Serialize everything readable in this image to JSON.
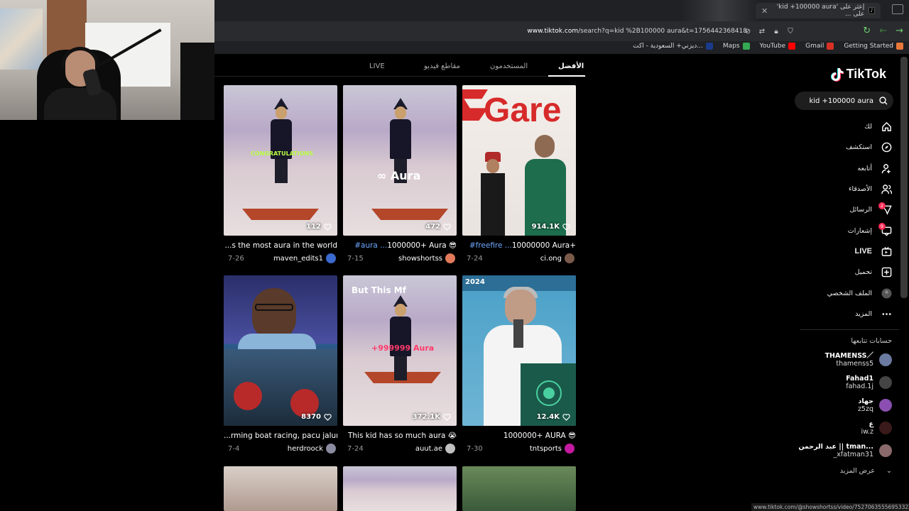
{
  "browser": {
    "tab_title": "إعثر على 'kid +100000 aura' على ...",
    "url_host": "www.tiktok.com",
    "url_path": "/search?q=kid %2B100000 aura&t=1756442368418",
    "bookmarks": [
      {
        "label": "Getting Started",
        "color": "#e8773a"
      },
      {
        "label": "Gmail",
        "color": "#d93025"
      },
      {
        "label": "YouTube",
        "color": "#ff0000"
      },
      {
        "label": "Maps",
        "color": "#34a853"
      },
      {
        "label": "ديزني+ السعودية - اكت...",
        "color": "#1a3a8a"
      }
    ],
    "status_url": "www.tiktok.com/@showshortss/video/7527063555695332230"
  },
  "tiktok": {
    "logo": "TikTok",
    "search_value": "kid +100000 aura",
    "nav": [
      {
        "label": "لك",
        "icon": "home-icon"
      },
      {
        "label": "استكشف",
        "icon": "compass-icon"
      },
      {
        "label": "أتابعه",
        "icon": "following-icon"
      },
      {
        "label": "الأصدقاء",
        "icon": "friends-icon"
      },
      {
        "label": "الرسائل",
        "icon": "messages-icon",
        "badge": "2"
      },
      {
        "label": "إشعارات",
        "icon": "inbox-icon",
        "badge": "9"
      },
      {
        "label": "LIVE",
        "icon": "live-icon"
      },
      {
        "label": "تحميل",
        "icon": "upload-icon"
      },
      {
        "label": "الملف الشخصي",
        "icon": "profile-avatar-icon"
      },
      {
        "label": "المزيد",
        "icon": "more-icon"
      }
    ],
    "following_title": "حسابات تتابعها",
    "accounts": [
      {
        "name": "THAMENSS／",
        "user": "thamenss5",
        "color": "#6a7aa0"
      },
      {
        "name": "Fahad1",
        "user": "fahad.1j",
        "color": "#444"
      },
      {
        "name": "جهاد",
        "user": "z5zq",
        "color": "#8a4fb0"
      },
      {
        "name": "ع",
        "user": "iw.z",
        "color": "#3a1a1a"
      },
      {
        "name": "عبد الرحمن || tman...",
        "user": "_xfatman31",
        "color": "#8a6a6a"
      }
    ],
    "see_more": "عرض المزيد",
    "tabs": {
      "top": "الأفضل",
      "users": "المستخدمون",
      "videos": "مقاطع فيديو",
      "live": "LIVE"
    }
  },
  "videos": [
    {
      "likes": "112",
      "caption": "...s the most aura in the world",
      "tag": "",
      "author": "maven_edits1",
      "author_color": "#3a6ad0",
      "date": "7-26",
      "overlay": "CONGRATULATIONS"
    },
    {
      "likes": "472",
      "caption": "1000000+ Aura 😎 ",
      "tag": "#aura ...",
      "author": "showshortss",
      "author_color": "#e07a5a",
      "date": "7-15",
      "overlay": "∞ Aura"
    },
    {
      "likes": "914.1K",
      "caption": "10000000 Aura+ ",
      "tag": "#freefire ...",
      "author": "ci.ong",
      "author_color": "#7a5a4a",
      "date": "7-24",
      "overlay": "Gare"
    },
    {
      "likes": "8370",
      "caption": "...rming boat racing, pacu jalur",
      "tag": "",
      "author": "herdroock",
      "author_color": "#8a8aa0",
      "date": "7-4",
      "overlay": ""
    },
    {
      "likes": "372.1K",
      "caption": "This kid has so much aura 😭",
      "tag": "",
      "author": "auut.ae",
      "author_color": "#c0c0c0",
      "date": "7-24",
      "overlay": "But This Mf"
    },
    {
      "likes": "12.4K",
      "caption": "1000000+ AURA 😎",
      "tag": "",
      "author": "tntsports",
      "author_color": "#c41aa0",
      "date": "7-30",
      "overlay": "2024"
    }
  ],
  "colors": {
    "accent": "#fe2c55",
    "hashtag": "#6fa8ff",
    "bg": "#000000"
  }
}
